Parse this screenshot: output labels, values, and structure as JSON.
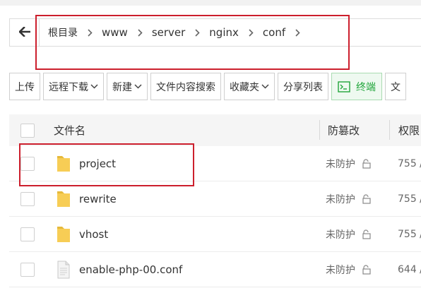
{
  "breadcrumb": {
    "items": [
      "根目录",
      "www",
      "server",
      "nginx",
      "conf"
    ]
  },
  "toolbar": {
    "upload": "上传",
    "remote_download": "远程下载",
    "new": "新建",
    "content_search": "文件内容搜索",
    "favorites": "收藏夹",
    "share_list": "分享列表",
    "terminal": "终端",
    "file_more": "文"
  },
  "table": {
    "headers": {
      "name": "文件名",
      "tamper": "防篡改",
      "perm": "权限"
    },
    "rows": [
      {
        "name": "project",
        "type": "folder",
        "tamper": "未防护",
        "perm": "755 /"
      },
      {
        "name": "rewrite",
        "type": "folder",
        "tamper": "未防护",
        "perm": "755 /"
      },
      {
        "name": "vhost",
        "type": "folder",
        "tamper": "未防护",
        "perm": "755 /"
      },
      {
        "name": "enable-php-00.conf",
        "type": "file",
        "tamper": "未防护",
        "perm": "644 /"
      }
    ]
  },
  "colors": {
    "accent_green": "#20a53a",
    "highlight_red": "#cc1f2d",
    "folder_yellow": "#f7cd55"
  },
  "icons": {
    "back": "arrow-left-icon",
    "separator": "chevron-right-icon",
    "folder": "folder-icon",
    "file": "file-icon",
    "lock": "unlock-icon",
    "terminal": "terminal-icon"
  }
}
